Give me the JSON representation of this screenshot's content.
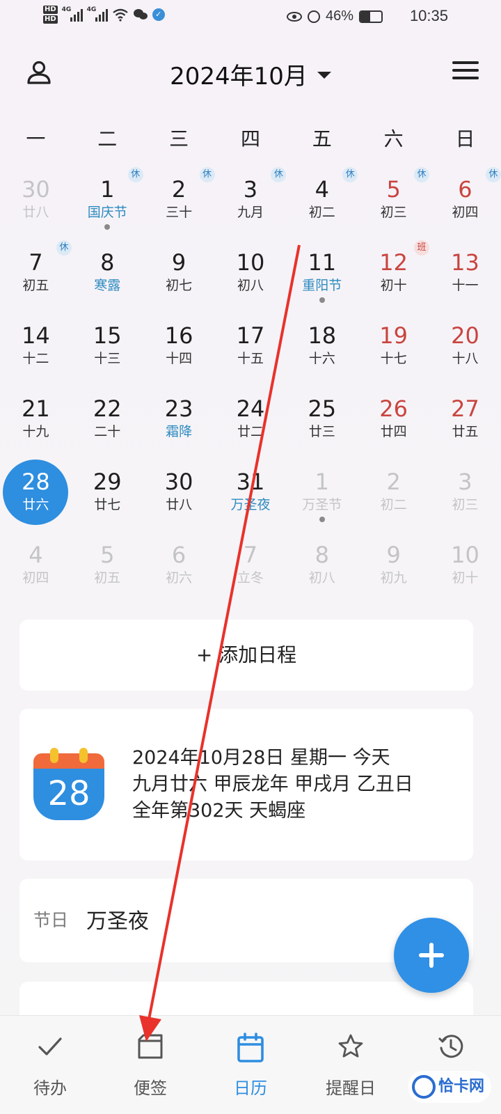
{
  "status_bar": {
    "network_1": "4G",
    "network_2": "4G",
    "hd_1": "HD",
    "hd_2": "HD",
    "battery_percent": "46%",
    "battery_level": 0.46,
    "time": "10:35"
  },
  "header": {
    "month_title": "2024年10月"
  },
  "weekdays": [
    "一",
    "二",
    "三",
    "四",
    "五",
    "六",
    "日"
  ],
  "weeks": [
    [
      {
        "num": "30",
        "lunar": "廿八",
        "other": true
      },
      {
        "num": "1",
        "lunar": "国庆节",
        "festival": true,
        "badge": "休",
        "dot": true
      },
      {
        "num": "2",
        "lunar": "三十",
        "badge": "休"
      },
      {
        "num": "3",
        "lunar": "九月",
        "badge": "休"
      },
      {
        "num": "4",
        "lunar": "初二",
        "badge": "休"
      },
      {
        "num": "5",
        "lunar": "初三",
        "weekend": true,
        "badge": "休"
      },
      {
        "num": "6",
        "lunar": "初四",
        "weekend": true,
        "badge": "休"
      }
    ],
    [
      {
        "num": "7",
        "lunar": "初五",
        "badge": "休"
      },
      {
        "num": "8",
        "lunar": "寒露",
        "festival": true
      },
      {
        "num": "9",
        "lunar": "初七"
      },
      {
        "num": "10",
        "lunar": "初八"
      },
      {
        "num": "11",
        "lunar": "重阳节",
        "festival": true,
        "dot": true
      },
      {
        "num": "12",
        "lunar": "初十",
        "weekend": true,
        "badge": "班",
        "badge_work": true
      },
      {
        "num": "13",
        "lunar": "十一",
        "weekend": true
      }
    ],
    [
      {
        "num": "14",
        "lunar": "十二"
      },
      {
        "num": "15",
        "lunar": "十三"
      },
      {
        "num": "16",
        "lunar": "十四"
      },
      {
        "num": "17",
        "lunar": "十五"
      },
      {
        "num": "18",
        "lunar": "十六"
      },
      {
        "num": "19",
        "lunar": "十七",
        "weekend": true
      },
      {
        "num": "20",
        "lunar": "十八",
        "weekend": true
      }
    ],
    [
      {
        "num": "21",
        "lunar": "十九"
      },
      {
        "num": "22",
        "lunar": "二十"
      },
      {
        "num": "23",
        "lunar": "霜降",
        "festival": true
      },
      {
        "num": "24",
        "lunar": "廿二"
      },
      {
        "num": "25",
        "lunar": "廿三"
      },
      {
        "num": "26",
        "lunar": "廿四",
        "weekend": true
      },
      {
        "num": "27",
        "lunar": "廿五",
        "weekend": true
      }
    ],
    [
      {
        "num": "28",
        "lunar": "廿六",
        "today": true
      },
      {
        "num": "29",
        "lunar": "廿七"
      },
      {
        "num": "30",
        "lunar": "廿八"
      },
      {
        "num": "31",
        "lunar": "万圣夜",
        "festival": true
      },
      {
        "num": "1",
        "lunar": "万圣节",
        "other": true,
        "dot": true
      },
      {
        "num": "2",
        "lunar": "初二",
        "other": true
      },
      {
        "num": "3",
        "lunar": "初三",
        "other": true
      }
    ],
    [
      {
        "num": "4",
        "lunar": "初四",
        "other": true
      },
      {
        "num": "5",
        "lunar": "初五",
        "other": true
      },
      {
        "num": "6",
        "lunar": "初六",
        "other": true
      },
      {
        "num": "7",
        "lunar": "立冬",
        "other": true
      },
      {
        "num": "8",
        "lunar": "初八",
        "other": true
      },
      {
        "num": "9",
        "lunar": "初九",
        "other": true
      },
      {
        "num": "10",
        "lunar": "初十",
        "other": true
      }
    ]
  ],
  "add_schedule": {
    "label": "+ 添加日程"
  },
  "date_card": {
    "icon_day": "28",
    "line1": "2024年10月28日 星期一 今天",
    "line2": "九月廿六 甲辰龙年 甲戌月 乙丑日",
    "line3": "全年第302天 天蝎座"
  },
  "holiday_card": {
    "label": "节日",
    "name": "万圣夜"
  },
  "bottom_nav": [
    {
      "label": "待办",
      "icon": "check-icon"
    },
    {
      "label": "便签",
      "icon": "note-icon"
    },
    {
      "label": "日历",
      "icon": "calendar-icon",
      "active": true
    },
    {
      "label": "提醒日",
      "icon": "star-icon"
    },
    {
      "label": "",
      "icon": "history-icon"
    }
  ],
  "watermark": {
    "text": "恰卡网"
  },
  "colors": {
    "accent": "#2e8ee0",
    "weekend": "#c9453f",
    "festival": "#2e8bc0",
    "annotation_arrow": "#e8322b"
  }
}
